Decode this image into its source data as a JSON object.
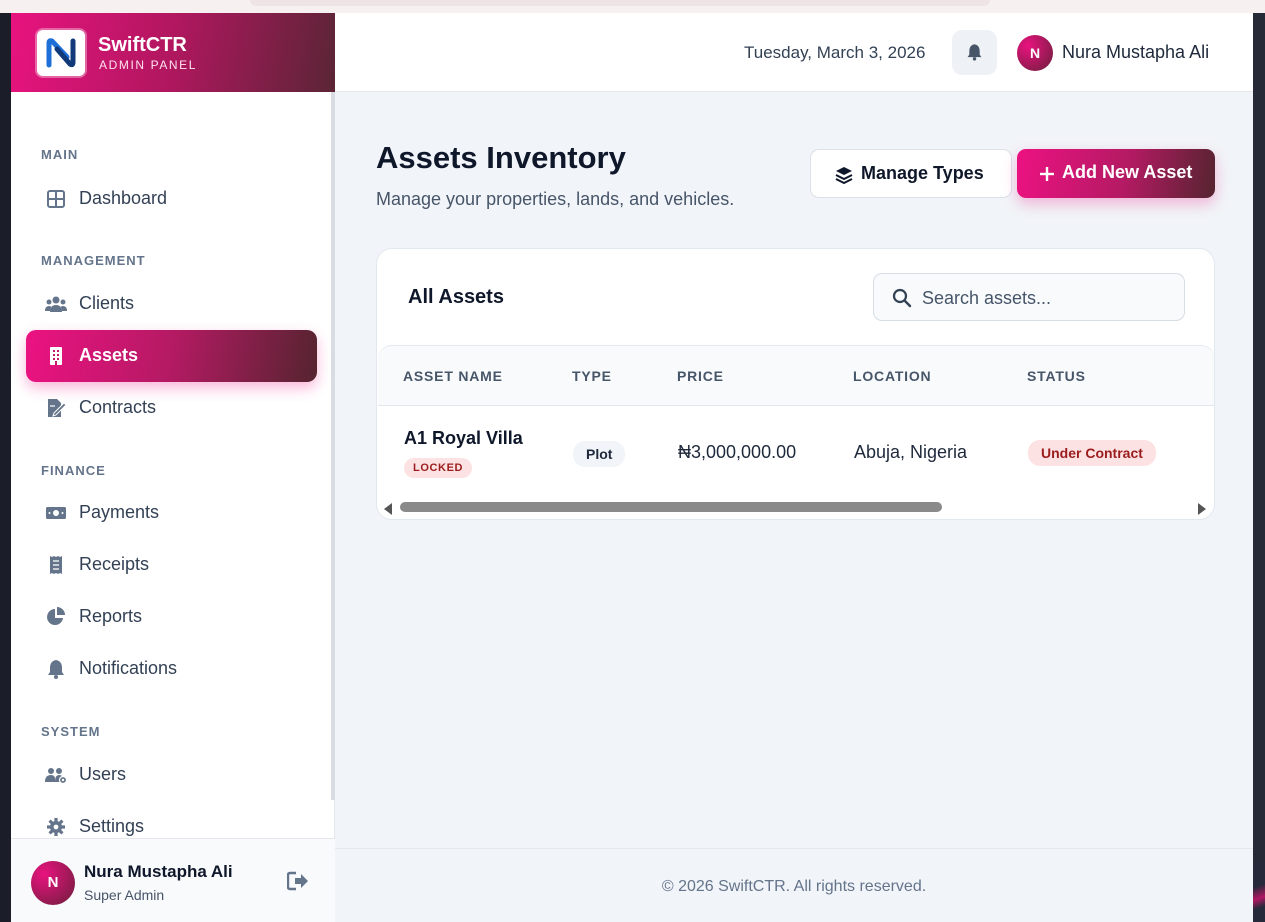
{
  "brand": {
    "name": "SwiftCTR",
    "subtitle": "ADMIN PANEL"
  },
  "header": {
    "date": "Tuesday, March 3, 2026",
    "user_initial": "N",
    "user_name": "Nura Mustapha Ali"
  },
  "sidebar": {
    "sections": {
      "main": "MAIN",
      "management": "MANAGEMENT",
      "finance": "FINANCE",
      "system": "SYSTEM"
    },
    "items": {
      "dashboard": "Dashboard",
      "clients": "Clients",
      "assets": "Assets",
      "contracts": "Contracts",
      "payments": "Payments",
      "receipts": "Receipts",
      "reports": "Reports",
      "notifications": "Notifications",
      "users": "Users",
      "settings": "Settings"
    },
    "active_item": "assets",
    "user": {
      "initial": "N",
      "name": "Nura Mustapha Ali",
      "role": "Super Admin"
    }
  },
  "main": {
    "title": "Assets Inventory",
    "subtitle": "Manage your properties, lands, and vehicles.",
    "manage_types_label": "Manage Types",
    "add_asset_label": "Add New Asset",
    "card_title": "All Assets",
    "search_placeholder": "Search assets...",
    "columns": [
      "ASSET NAME",
      "TYPE",
      "PRICE",
      "LOCATION",
      "STATUS"
    ],
    "rows": [
      {
        "name": "A1 Royal Villa",
        "badge": "LOCKED",
        "type": "Plot",
        "price": "₦3,000,000.00",
        "location": "Abuja, Nigeria",
        "status": "Under Contract"
      }
    ]
  },
  "footer": {
    "text": "© 2026 SwiftCTR. All rights reserved."
  },
  "colors": {
    "accent": "#ec1282",
    "accent_dark": "#55242f",
    "status_red": "#9b1c1c"
  }
}
